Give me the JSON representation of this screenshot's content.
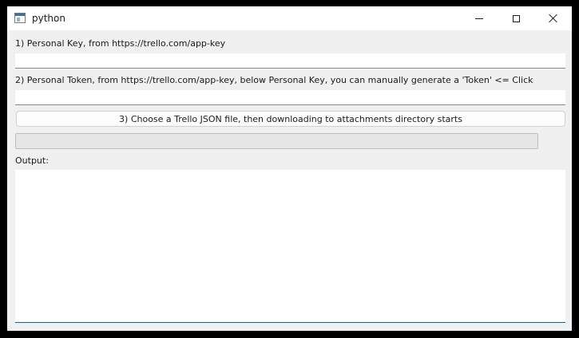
{
  "window": {
    "title": "python"
  },
  "form": {
    "key_label": "1) Personal Key, from https://trello.com/app-key",
    "key_value": "",
    "token_label": "2) Personal Token, from https://trello.com/app-key, below Personal Key, you can manually generate a 'Token' <= Click",
    "token_value": "",
    "choose_button_label": "3) Choose a Trello JSON file, then downloading to attachments directory starts",
    "progress_fraction": 0,
    "output_label": "Output:",
    "output_text": ""
  },
  "icons": {
    "app": "app-window-icon",
    "minimize": "minimize-icon",
    "maximize": "maximize-icon",
    "close": "close-icon"
  },
  "colors": {
    "window_bg": "#f0f0f0",
    "titlebar_bg": "#ffffff",
    "focus_accent": "#0067c0",
    "progress_fill": "#06b025"
  }
}
